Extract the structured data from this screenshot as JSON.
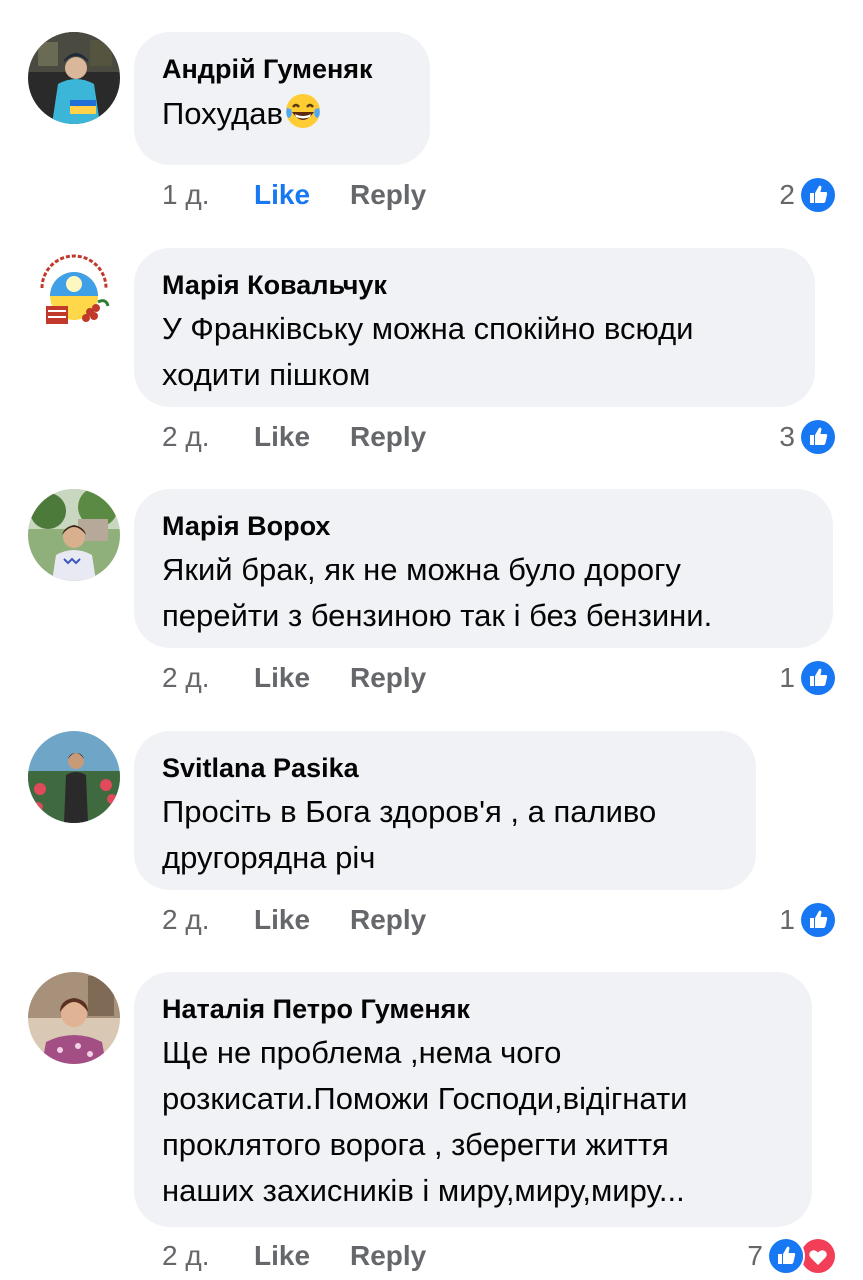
{
  "colors": {
    "bubble_bg": "#f0f2f5",
    "like_blue": "#1877f2",
    "love_red": "#f33e58",
    "meta_gray": "#65676b"
  },
  "comments": [
    {
      "author": "Андрій Гуменяк",
      "text": "Похудав",
      "emoji": "laughing-crying-emoji",
      "time": "1 д.",
      "like_label": "Like",
      "liked": true,
      "reply_label": "Reply",
      "reaction_count": "2",
      "reactions": [
        "like-icon"
      ]
    },
    {
      "author": "Марія Ковальчук",
      "text_lines": [
        "У Франківську можна спокійно всюди",
        "ходити пішком"
      ],
      "time": "2 д.",
      "like_label": "Like",
      "reply_label": "Reply",
      "reaction_count": "3",
      "reactions": [
        "like-icon"
      ]
    },
    {
      "author": "Марія Ворох",
      "text_lines": [
        "Який брак, як не можна було дорогу",
        "перейти з бензиною так і без бензини."
      ],
      "time": "2 д.",
      "like_label": "Like",
      "reply_label": "Reply",
      "reaction_count": "1",
      "reactions": [
        "like-icon"
      ]
    },
    {
      "author": "Svitlana Pasika",
      "text_lines": [
        "Просіть в Бога здоров'я , а паливо",
        "другорядна річ"
      ],
      "time": "2 д.",
      "like_label": "Like",
      "reply_label": "Reply",
      "reaction_count": "1",
      "reactions": [
        "like-icon"
      ]
    },
    {
      "author": "Наталія Петро Гуменяк",
      "text_lines": [
        "Ще не проблема ,нема чого",
        "розкисати.Поможи Господи,відігнати",
        "проклятого ворога , зберегти життя",
        "наших захисників і миру,миру,миру..."
      ],
      "time": "2 д.",
      "like_label": "Like",
      "reply_label": "Reply",
      "reaction_count": "7",
      "reactions": [
        "like-icon",
        "love-icon"
      ]
    }
  ]
}
